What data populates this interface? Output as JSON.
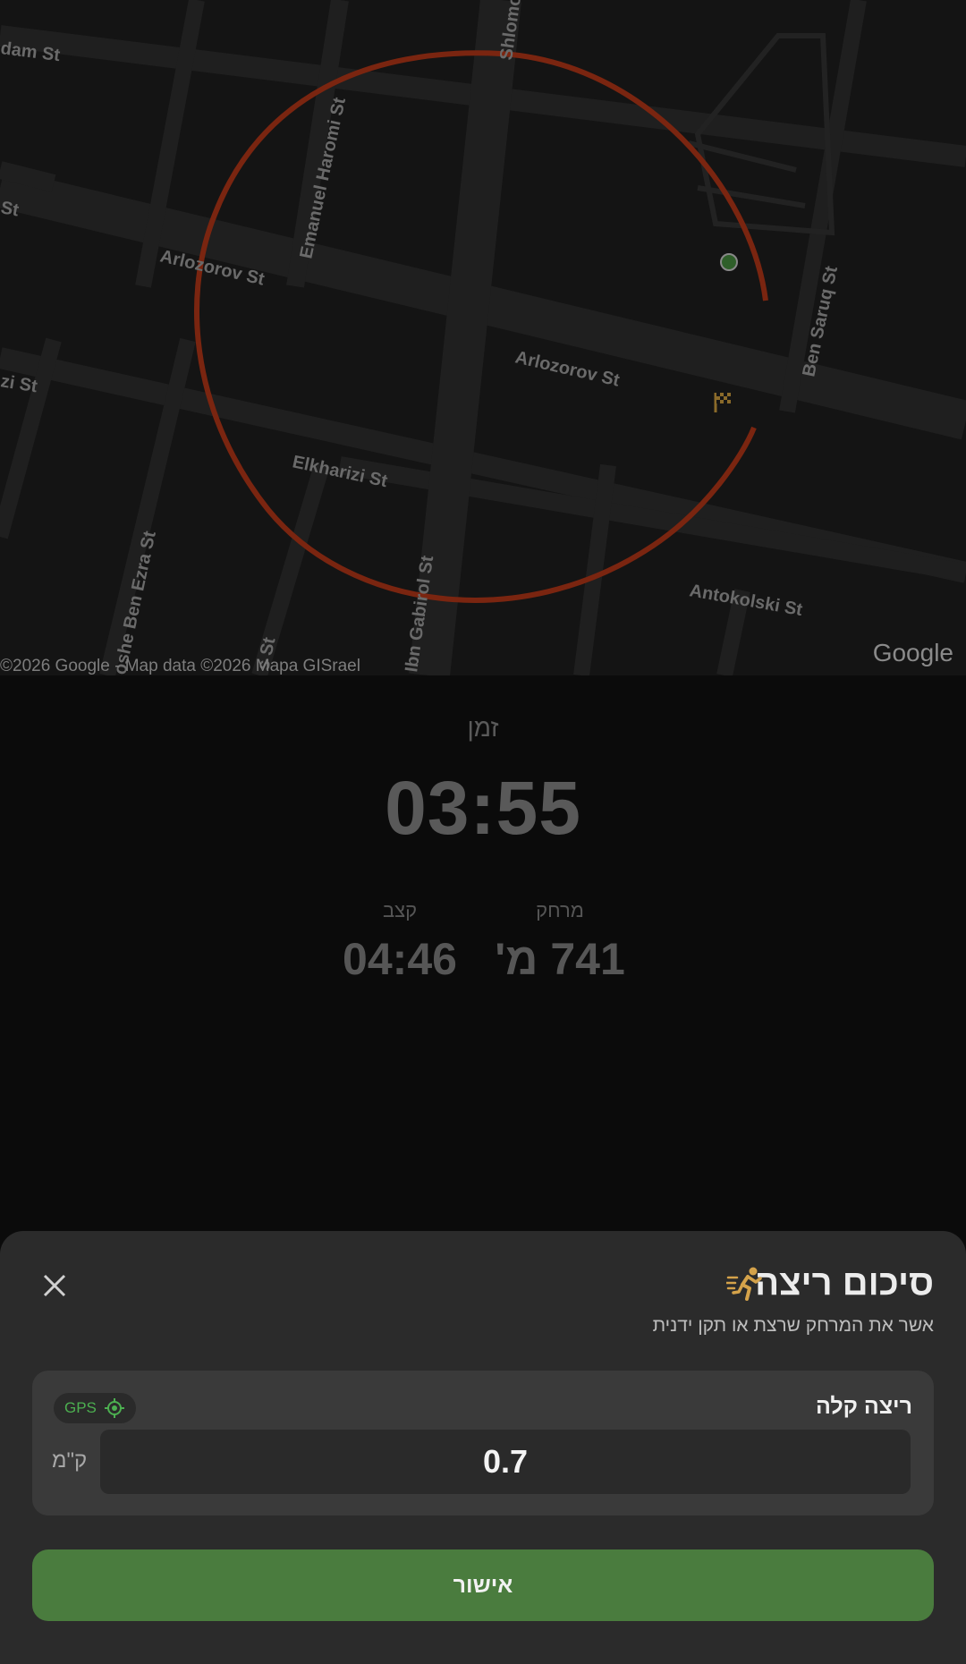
{
  "map": {
    "streets": {
      "adam": "dam St",
      "st_left": "St",
      "arlozorov_1": "Arlozorov St",
      "arlozorov_2": "Arlozorov St",
      "emanuel": "Emanuel Haromi St",
      "shlomo": "Shlomo",
      "ben_saruq": "Ben Saruq St",
      "zi_st": "zi St",
      "elkharizi": "Elkharizi St",
      "antokolski": "Antokolski St",
      "ibn_gabirol": "Ibn Gabirol St",
      "moshe_ben_ezra": "oshe Ben Ezra St",
      "s_st": "s St"
    },
    "attribution": "©2026 Google - Map data ©2026 Mapa GISrael",
    "logo": "Google",
    "route_color": "#7a2510",
    "finish_flag_color": "#8a6a2a",
    "current_location_color": "#4caf50"
  },
  "stats": {
    "time_label": "זמן",
    "time_value": "03:55",
    "distance_label": "מרחק",
    "distance_value": "741 מ'",
    "pace_label": "קצב",
    "pace_value": "04:46"
  },
  "sheet": {
    "title": "סיכום ריצה",
    "title_icon": "running-person-icon",
    "subtitle": "אשר את המרחק שרצת או תקן ידנית",
    "card_title": "ריצה קלה",
    "gps_label": "GPS",
    "distance_input_value": "0.7",
    "unit": "ק\"מ",
    "confirm_label": "אישור",
    "accent_green": "#4a7c3e",
    "gps_color": "#4caf50"
  }
}
